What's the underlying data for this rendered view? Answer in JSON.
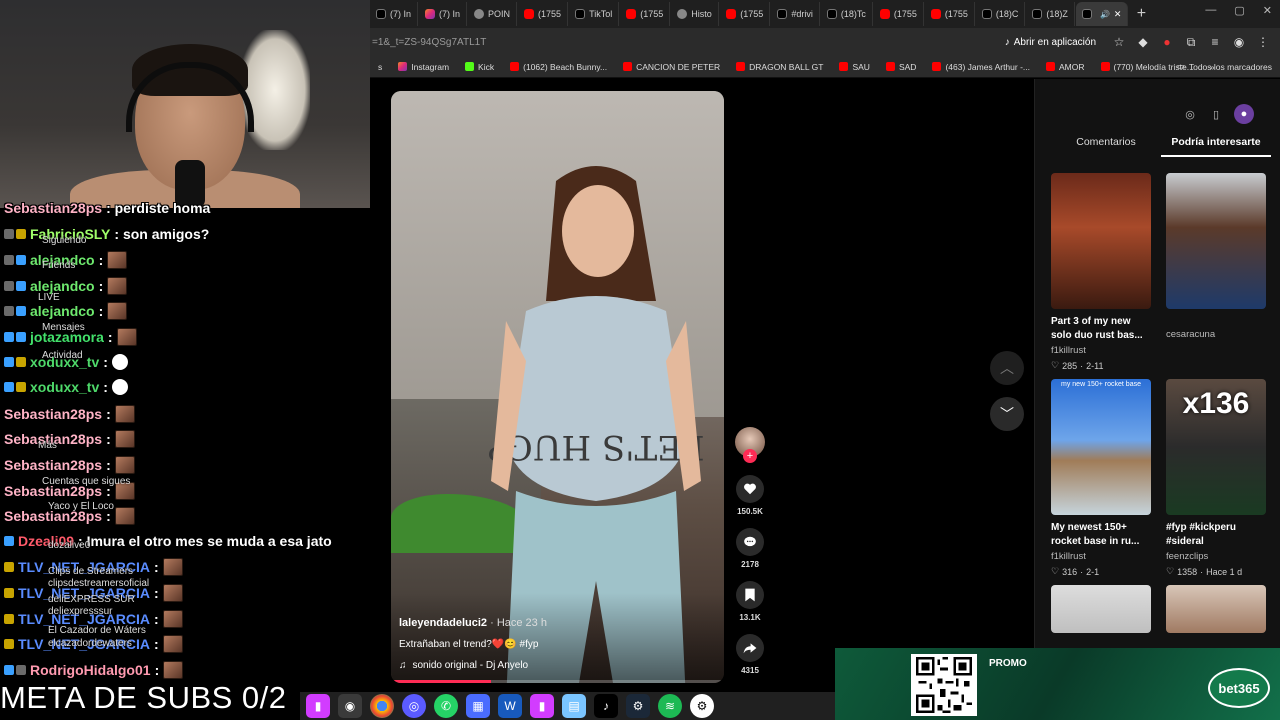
{
  "browser": {
    "tabs": [
      {
        "label": "(7) In",
        "icon": "tiktok"
      },
      {
        "label": "(7) In",
        "icon": "instagram"
      },
      {
        "label": "POIN",
        "icon": "generic"
      },
      {
        "label": "(1755",
        "icon": "youtube"
      },
      {
        "label": "TikTol",
        "icon": "tiktok"
      },
      {
        "label": "(1755",
        "icon": "youtube"
      },
      {
        "label": "Histo",
        "icon": "generic"
      },
      {
        "label": "(1755",
        "icon": "youtube"
      },
      {
        "label": "#drivi",
        "icon": "tiktok"
      },
      {
        "label": "(18)Tc",
        "icon": "tiktok"
      },
      {
        "label": "(1755",
        "icon": "youtube"
      },
      {
        "label": "(1755",
        "icon": "youtube"
      },
      {
        "label": "(18)C",
        "icon": "tiktok"
      },
      {
        "label": "(18)Z",
        "icon": "tiktok"
      },
      {
        "label": "",
        "icon": "tiktok",
        "active": true
      }
    ],
    "url": "=1&_t=ZS-94QSg7ATL1T",
    "open_app": "Abrir en aplicación",
    "bookmarks": [
      {
        "label": "Instagram",
        "icon": "instagram"
      },
      {
        "label": "Kick",
        "icon": "kick"
      },
      {
        "label": "(1062) Beach Bunny...",
        "icon": "youtube"
      },
      {
        "label": "CANCION DE PETER",
        "icon": "youtube"
      },
      {
        "label": "DRAGON BALL GT",
        "icon": "youtube"
      },
      {
        "label": "SAU",
        "icon": "youtube"
      },
      {
        "label": "SAD",
        "icon": "youtube"
      },
      {
        "label": "(463) James Arthur -...",
        "icon": "youtube"
      },
      {
        "label": "AMOR",
        "icon": "youtube"
      },
      {
        "label": "(770) Melodía triste...",
        "icon": "youtube"
      }
    ],
    "all_bookmarks": "Todos los marcadores"
  },
  "video": {
    "shirt_text": "LET'S HUG?",
    "author": "laleyendadeluci2",
    "ago": " · Hace 23 h",
    "description": "Extrañaban el trend?❤️😊 #fyp",
    "sound": "sonido original - Dj Anyelo",
    "progress": 0.3,
    "likes": "150.5K",
    "comments": "2178",
    "saves": "13.1K",
    "shares": "4315"
  },
  "panel": {
    "tabs": [
      "Comentarios",
      "Podría interesarte"
    ],
    "active_tab": 1,
    "cards": [
      {
        "title": "Part 3 of my new solo duo rust bas...",
        "author": "f1killrust",
        "likes": "285",
        "date": "2-11",
        "thumb_label": "",
        "big": ""
      },
      {
        "title": "",
        "author": "cesaracuna",
        "likes": "",
        "date": "",
        "thumb_label": "",
        "big": ""
      },
      {
        "title": "My newest 150+ rocket base in ru...",
        "author": "f1killrust",
        "likes": "316",
        "date": "2-1",
        "thumb_label": "my new 150+ rocket base",
        "big": ""
      },
      {
        "title": "#fyp #kickperu #sideral",
        "author": "feenzclips",
        "likes": "1358",
        "date": "Hace 1 d",
        "thumb_label": "",
        "big": "x136"
      },
      {
        "title": "",
        "author": "",
        "likes": "",
        "date": "",
        "thumb_label": "",
        "big": ""
      },
      {
        "title": "",
        "author": "",
        "likes": "",
        "date": "",
        "thumb_label": "",
        "big": ""
      }
    ]
  },
  "chat": {
    "messages": [
      {
        "user": "Sebastian28ps",
        "text": ": perdiste homa",
        "color": "#ffb3c6",
        "badges": [],
        "emote": false
      },
      {
        "user": "FabricioSLY",
        "text": ": son amigos?",
        "color": "#a0ff6a",
        "badges": [
          "mod",
          "sub"
        ],
        "emote": false
      },
      {
        "user": "alejandco",
        "text": ":",
        "color": "#6ee96e",
        "badges": [
          "mod",
          "prime"
        ],
        "emote": true
      },
      {
        "user": "alejandco",
        "text": ":",
        "color": "#6ee96e",
        "badges": [
          "mod",
          "prime"
        ],
        "emote": true
      },
      {
        "user": "alejandco",
        "text": ":",
        "color": "#6ee96e",
        "badges": [
          "mod",
          "prime"
        ],
        "emote": true
      },
      {
        "user": "jotazamora",
        "text": ":",
        "color": "#42e06a",
        "badges": [
          "prime",
          "prime"
        ],
        "emote": true
      },
      {
        "user": "xoduxx_tv",
        "text": ":",
        "color": "#4ed96a",
        "badges": [
          "prime",
          "sub"
        ],
        "emote": "ghost"
      },
      {
        "user": "xoduxx_tv",
        "text": ":",
        "color": "#4ed96a",
        "badges": [
          "prime",
          "sub"
        ],
        "emote": "ghost"
      },
      {
        "user": "Sebastian28ps",
        "text": ":",
        "color": "#ffb3c6",
        "badges": [],
        "emote": true
      },
      {
        "user": "Sebastian28ps",
        "text": ":",
        "color": "#ffb3c6",
        "badges": [],
        "emote": true
      },
      {
        "user": "Sebastian28ps",
        "text": ":",
        "color": "#ffb3c6",
        "badges": [],
        "emote": true
      },
      {
        "user": "Sebastian28ps",
        "text": ":",
        "color": "#ffb3c6",
        "badges": [],
        "emote": true
      },
      {
        "user": "Sebastian28ps",
        "text": ":",
        "color": "#ffb3c6",
        "badges": [],
        "emote": true
      },
      {
        "user": "Dzeali09",
        "text": ": Imura el otro mes se muda a esa jato",
        "color": "#ff5a6a",
        "badges": [
          "prime"
        ],
        "emote": false
      },
      {
        "user": "TLV_NET_JGARCIA",
        "text": ":",
        "color": "#5a8cff",
        "badges": [
          "sub"
        ],
        "emote": true
      },
      {
        "user": "TLV_NET_JGARCIA",
        "text": ":",
        "color": "#5a8cff",
        "badges": [
          "sub"
        ],
        "emote": true
      },
      {
        "user": "TLV_NET_JGARCIA",
        "text": ":",
        "color": "#5a8cff",
        "badges": [
          "sub"
        ],
        "emote": true
      },
      {
        "user": "TLV_NET_JGARCIA",
        "text": ":",
        "color": "#5a8cff",
        "badges": [
          "sub"
        ],
        "emote": true
      },
      {
        "user": "RodrigoHidalgo01",
        "text": ":",
        "color": "#ff9ab0",
        "badges": [
          "prime",
          "mod"
        ],
        "emote": true
      }
    ],
    "ghost_labels": [
      "Siguiendo",
      "Friends",
      "LIVE",
      "Mensajes",
      "Actividad",
      "Más",
      "Cuentas que sigues",
      "Yaco y El Loco",
      "dozalive0",
      "Clips de Streamers",
      "clipsdestreamersoficial",
      "deliEXPRESS SUR",
      "deliexpresssur",
      "El Cazador de Wáters",
      "elcazadordewaters"
    ]
  },
  "overlay": {
    "meta_subs": "META DE SUBS 0/2"
  },
  "ad": {
    "promo": "PROMO",
    "brand": "bet365"
  }
}
